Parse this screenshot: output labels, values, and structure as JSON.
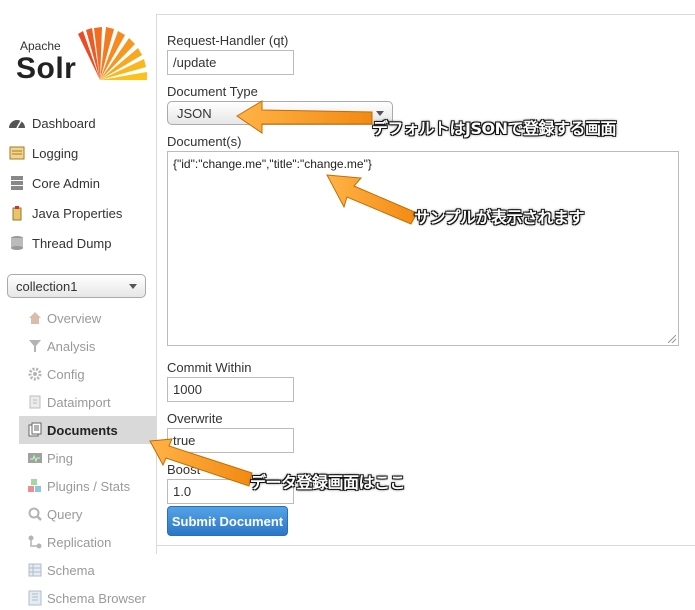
{
  "logo": {
    "apache": "Apache",
    "solr": "Solr"
  },
  "nav": [
    {
      "label": "Dashboard",
      "icon": "dashboard-icon"
    },
    {
      "label": "Logging",
      "icon": "logging-icon"
    },
    {
      "label": "Core Admin",
      "icon": "core-admin-icon"
    },
    {
      "label": "Java Properties",
      "icon": "java-icon"
    },
    {
      "label": "Thread Dump",
      "icon": "thread-dump-icon"
    }
  ],
  "core_selector": {
    "value": "collection1"
  },
  "core_menu": [
    {
      "label": "Overview",
      "icon": "home-icon"
    },
    {
      "label": "Analysis",
      "icon": "filter-icon"
    },
    {
      "label": "Config",
      "icon": "gear-icon"
    },
    {
      "label": "Dataimport",
      "icon": "import-icon"
    },
    {
      "label": "Documents",
      "icon": "documents-icon",
      "active": true
    },
    {
      "label": "Ping",
      "icon": "ping-icon"
    },
    {
      "label": "Plugins / Stats",
      "icon": "plugins-icon"
    },
    {
      "label": "Query",
      "icon": "query-icon"
    },
    {
      "label": "Replication",
      "icon": "replication-icon"
    },
    {
      "label": "Schema",
      "icon": "schema-icon"
    },
    {
      "label": "Schema Browser",
      "icon": "schema-browser-icon"
    }
  ],
  "form": {
    "request_handler_label": "Request-Handler (qt)",
    "request_handler_value": "/update",
    "document_type_label": "Document Type",
    "document_type_value": "JSON",
    "documents_label": "Document(s)",
    "documents_value": "{\"id\":\"change.me\",\"title\":\"change.me\"}",
    "commit_within_label": "Commit Within",
    "commit_within_value": "1000",
    "overwrite_label": "Overwrite",
    "overwrite_value": "true",
    "boost_label": "Boost",
    "boost_value": "1.0",
    "submit_label": "Submit Document"
  },
  "annotations": {
    "json_default": "デフォルトはJSONで登録する画面",
    "sample_shown": "サンプルが表示されます",
    "data_screen": "データ登録画面はここ"
  },
  "colors": {
    "accent_orange": "#f7931e",
    "button_blue": "#2a77c8",
    "logo_sun": "#f36f21"
  }
}
